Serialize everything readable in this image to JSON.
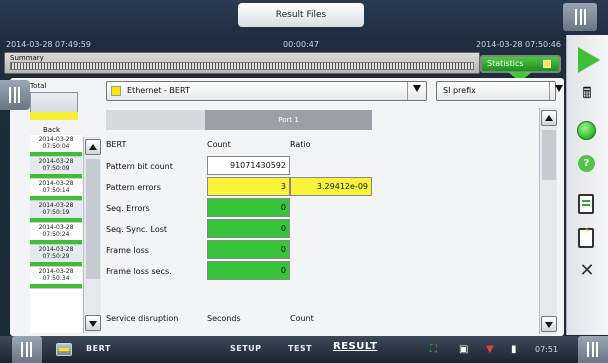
{
  "window": {
    "title": "Result Files"
  },
  "header": {
    "start_time": "2014-03-28 07:49:59",
    "elapsed": "00:00:47",
    "end_time": "2014-03-28 07:50:46",
    "summary_label": "Summary",
    "statistics_label": "Statistics"
  },
  "history": {
    "total_label": "Total",
    "back_label": "Back",
    "items": [
      {
        "date": "2014-03-28",
        "time": "07:50:04"
      },
      {
        "date": "2014-03-28",
        "time": "07:50:09"
      },
      {
        "date": "2014-03-28",
        "time": "07:50:14"
      },
      {
        "date": "2014-03-28",
        "time": "07:50:19"
      },
      {
        "date": "2014-03-28",
        "time": "07:50:24"
      },
      {
        "date": "2014-03-28",
        "time": "07:50:29"
      },
      {
        "date": "2014-03-28",
        "time": "07:50:34"
      }
    ]
  },
  "selectors": {
    "test": "Ethernet - BERT",
    "units": "SI prefix"
  },
  "results": {
    "port_label": "Port 1",
    "section": "BERT",
    "col_count": "Count",
    "col_ratio": "Ratio",
    "rows": [
      {
        "label": "Pattern bit count",
        "count": "91071430592",
        "ratio": ""
      },
      {
        "label": "Pattern errors",
        "count": "3",
        "ratio": "3.29412e-09"
      },
      {
        "label": "Seq. Errors",
        "count": "0",
        "ratio": ""
      },
      {
        "label": "Seq. Sync. Lost",
        "count": "0",
        "ratio": ""
      },
      {
        "label": "Frame loss",
        "count": "0",
        "ratio": ""
      },
      {
        "label": "Frame loss secs.",
        "count": "0",
        "ratio": ""
      }
    ],
    "service_disruption": {
      "label": "Service disruption",
      "col_seconds": "Seconds",
      "col_count": "Count"
    }
  },
  "bottom": {
    "test_name": "BERT",
    "nav": {
      "setup": "SETUP",
      "test": "TEST",
      "result": "RESULT"
    },
    "clock": "07:51"
  },
  "colors": {
    "green": "#37c33a",
    "yellow": "#fbf33a",
    "accent": "#3fbf38"
  },
  "icons": [
    "play-icon",
    "tools-icon",
    "status-led-icon",
    "help-icon",
    "document-icon",
    "report-icon",
    "close-icon",
    "network-icon",
    "media-icon",
    "wifi-icon",
    "battery-icon"
  ]
}
